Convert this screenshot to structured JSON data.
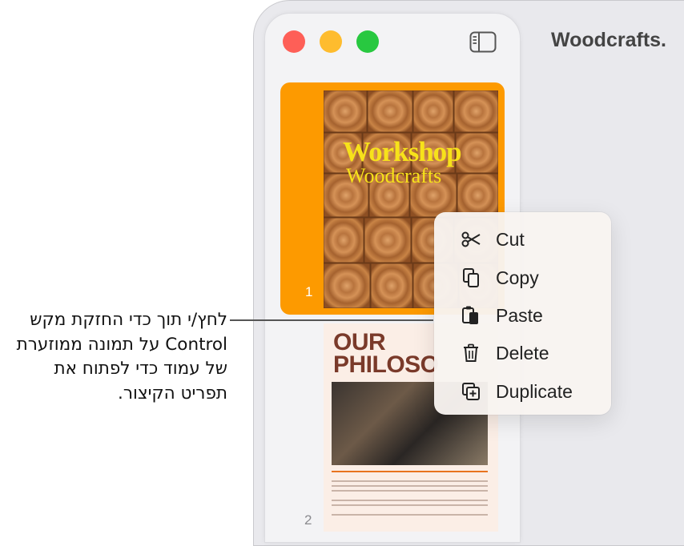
{
  "document": {
    "title": "Woodcrafts."
  },
  "sidebar": {
    "pages": [
      {
        "number": "1",
        "title_line1": "Workshop",
        "title_line2": "Woodcrafts"
      },
      {
        "number": "2",
        "heading": "OUR PHILOSO"
      }
    ]
  },
  "context_menu": {
    "items": [
      {
        "label": "Cut",
        "icon": "scissors-icon"
      },
      {
        "label": "Copy",
        "icon": "copy-icon"
      },
      {
        "label": "Paste",
        "icon": "paste-icon"
      },
      {
        "label": "Delete",
        "icon": "trash-icon"
      },
      {
        "label": "Duplicate",
        "icon": "duplicate-icon"
      }
    ]
  },
  "callout": {
    "text": "לחץ/י תוך כדי החזקת מקש Control על תמונה ממוזערת של עמוד כדי לפתוח את תפריט הקיצור."
  },
  "colors": {
    "selection": "#fd9a00",
    "red": "#fe5f57",
    "yellow": "#febc2e",
    "green": "#28c840",
    "brand_yellow": "#f7e21a",
    "heading_brown": "#7a3a2a"
  }
}
